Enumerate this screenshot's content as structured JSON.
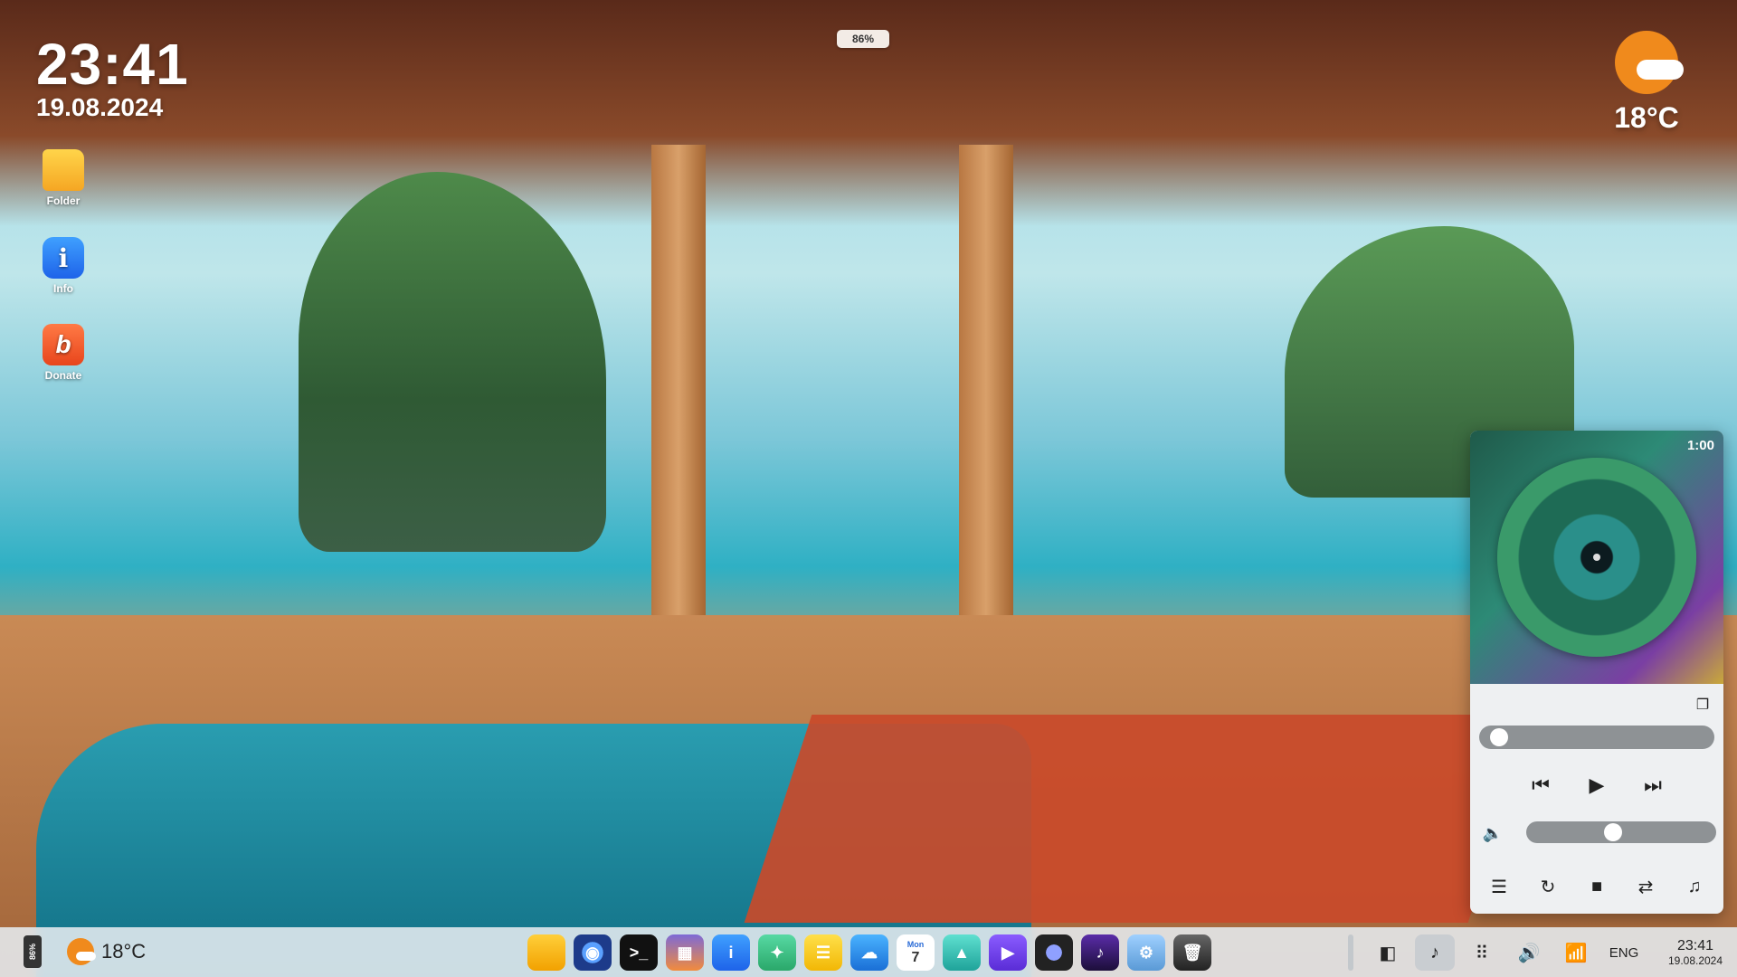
{
  "desktop": {
    "clock": {
      "time": "23:41",
      "date": "19.08.2024"
    },
    "battery_pill": "86%",
    "weather": {
      "temp": "18°C",
      "icon": "partly-cloudy-icon"
    },
    "icons": [
      {
        "label": "Folder",
        "icon": "folder-icon"
      },
      {
        "label": "Info",
        "icon": "info-icon"
      },
      {
        "label": "Donate",
        "icon": "donate-icon"
      }
    ]
  },
  "player": {
    "elapsed": "1:00",
    "seek_progress": 0.04,
    "volume_level": 0.45,
    "icons": [
      "copy-icon",
      "previous-icon",
      "play-icon",
      "next-icon",
      "volume-icon",
      "equalizer-icon",
      "refresh-icon",
      "stop-icon",
      "repeat-icon",
      "playlist-icon"
    ]
  },
  "taskbar": {
    "battery": "86%",
    "weather_temp": "18°C",
    "dock_apps": [
      "files-app",
      "browser-app",
      "terminal-app",
      "calculator-app",
      "info-app",
      "tools-app",
      "notes-app",
      "weather-app",
      "calendar-app",
      "photos-app",
      "video-player-app",
      "camera-app",
      "music-app",
      "settings-app",
      "trash-app"
    ],
    "calendar_day": "Mon",
    "calendar_date": "7",
    "language": "ENG",
    "time": "23:41",
    "date": "19.08.2024"
  }
}
